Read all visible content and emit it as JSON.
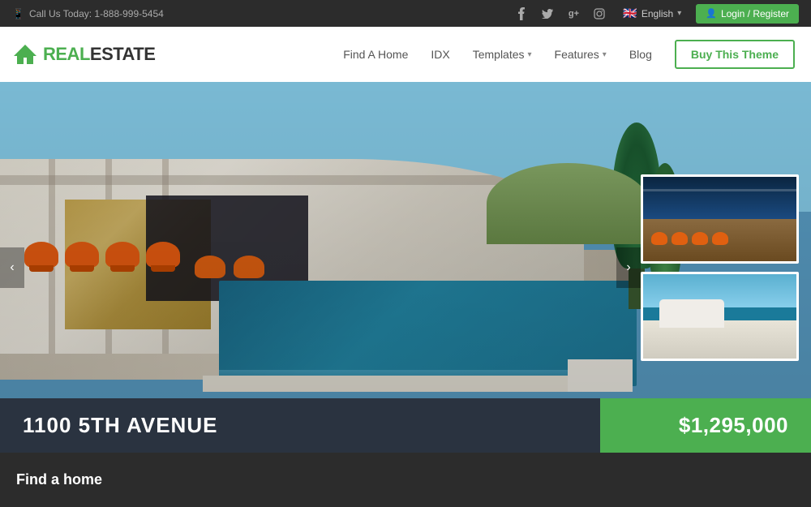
{
  "topbar": {
    "phone_icon": "📱",
    "phone_text": "Call Us Today: 1-888-999-5454",
    "social": [
      {
        "name": "facebook",
        "symbol": "f"
      },
      {
        "name": "twitter",
        "symbol": "t"
      },
      {
        "name": "google-plus",
        "symbol": "g+"
      },
      {
        "name": "instagram",
        "symbol": "📷"
      }
    ],
    "language": "English",
    "login_label": "Login / Register"
  },
  "nav": {
    "logo_real": "REAL",
    "logo_estate": "ESTATE",
    "links": [
      {
        "label": "Find A Home",
        "has_dropdown": false
      },
      {
        "label": "IDX",
        "has_dropdown": false
      },
      {
        "label": "Templates",
        "has_dropdown": true
      },
      {
        "label": "Features",
        "has_dropdown": true
      },
      {
        "label": "Blog",
        "has_dropdown": false
      }
    ],
    "buy_button": "Buy This Theme"
  },
  "hero": {
    "property_name": "1100 5TH AVENUE",
    "property_price": "$1,295,000",
    "arrow_left": "‹",
    "arrow_right": "›"
  },
  "find_home": {
    "title": "Find a home"
  }
}
